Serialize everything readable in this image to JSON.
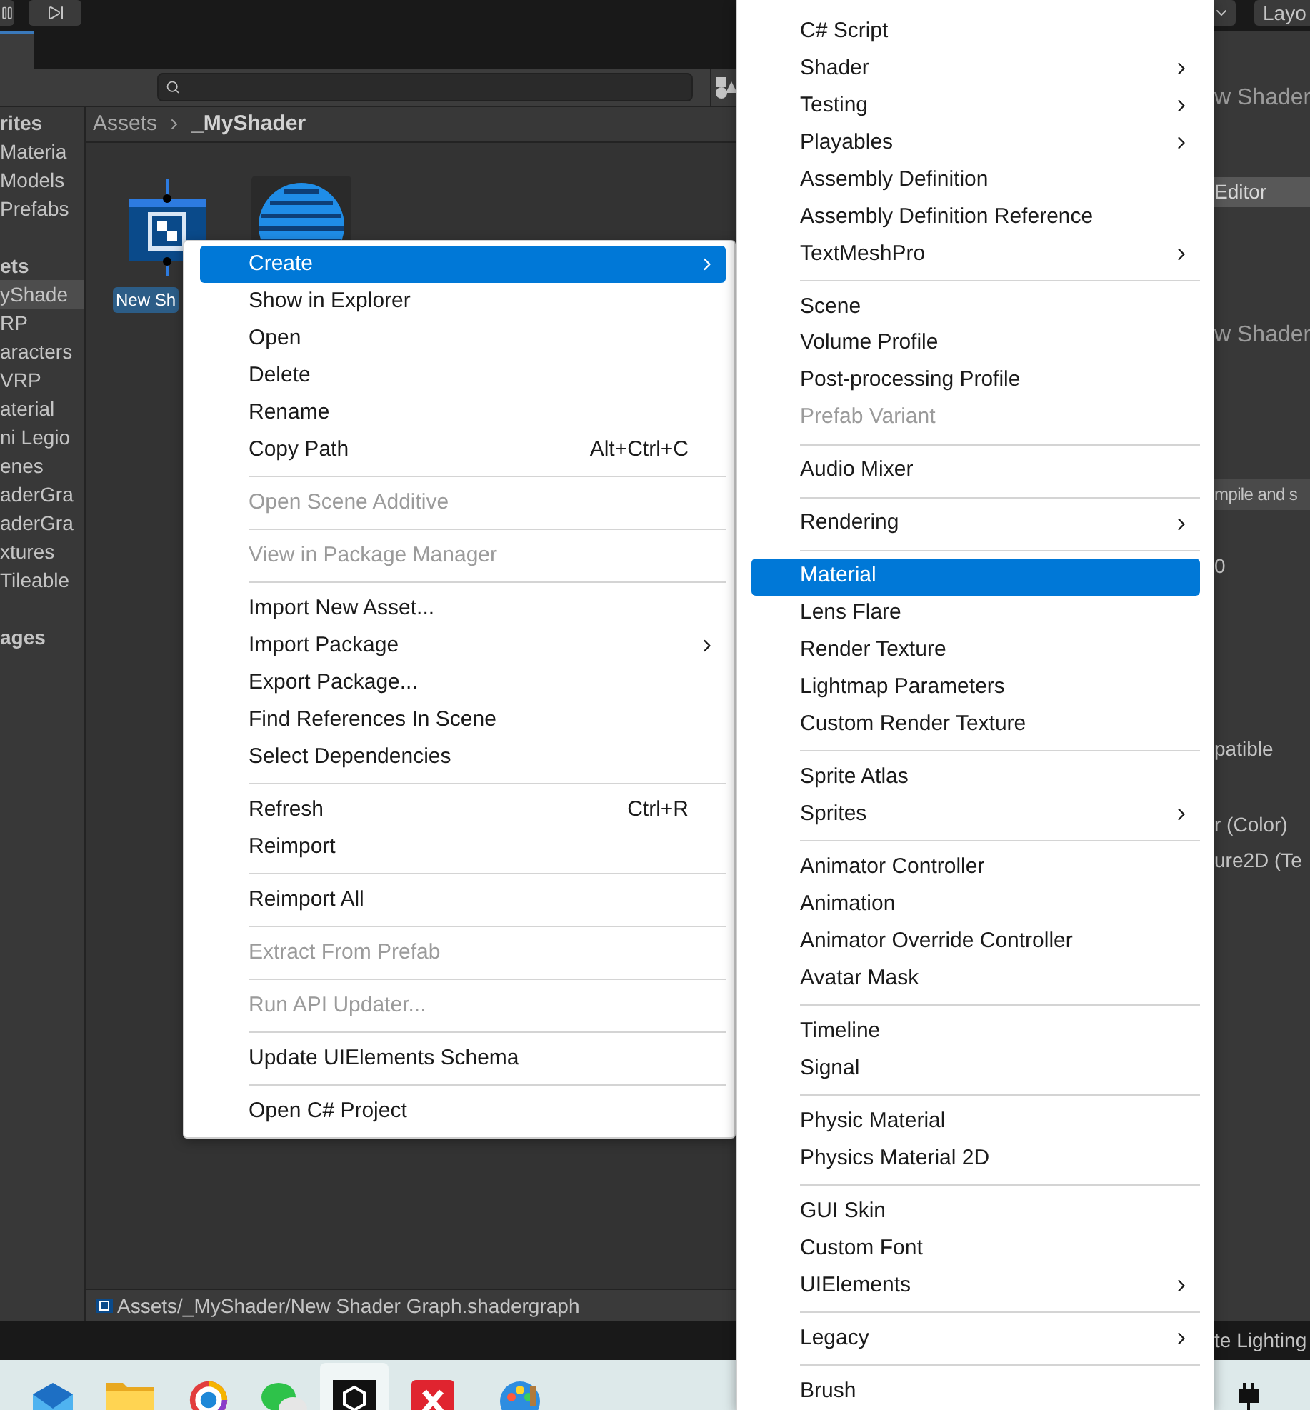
{
  "toolbar": {
    "layout_button": "Layo"
  },
  "sidebar": {
    "sections": [
      {
        "title": "rites",
        "items": [
          {
            "label": "Materia",
            "selected": false
          },
          {
            "label": "Models",
            "selected": false
          },
          {
            "label": "Prefabs",
            "selected": false
          }
        ]
      },
      {
        "title": "ets",
        "items": [
          {
            "label": "yShade",
            "selected": true
          },
          {
            "label": "RP",
            "selected": false
          },
          {
            "label": "aracters",
            "selected": false
          },
          {
            "label": "VRP",
            "selected": false
          },
          {
            "label": "aterial",
            "selected": false
          },
          {
            "label": "ni Legio",
            "selected": false
          },
          {
            "label": "enes",
            "selected": false
          },
          {
            "label": "aderGra",
            "selected": false
          },
          {
            "label": "aderGra",
            "selected": false
          },
          {
            "label": "xtures",
            "selected": false
          },
          {
            "label": "Tileable",
            "selected": false
          }
        ]
      },
      {
        "title": "ages"
      }
    ]
  },
  "breadcrumb": [
    "Assets",
    "_MyShader"
  ],
  "assets": [
    {
      "kind": "shader-graph",
      "label": "New Sh",
      "selected": true
    },
    {
      "kind": "material-sphere",
      "selected": false
    }
  ],
  "status_bar": {
    "path": "Assets/_MyShader/New Shader Graph.shadergraph"
  },
  "inspector": [
    {
      "kind": "title",
      "text": "w Shader"
    },
    {
      "kind": "button",
      "text": "Editor"
    },
    {
      "kind": "title",
      "text": "w Shader"
    },
    {
      "kind": "bar",
      "text": "mpile and s"
    },
    {
      "kind": "text",
      "text": "0"
    },
    {
      "kind": "text",
      "text": "patible"
    },
    {
      "kind": "text",
      "text": "r (Color)"
    },
    {
      "kind": "text",
      "text": "ure2D (Te"
    }
  ],
  "bottom_bar": {
    "text": "te Lighting"
  },
  "taskbar": [
    {
      "kind": "mail",
      "selected": false
    },
    {
      "kind": "folder",
      "selected": false
    },
    {
      "kind": "browser",
      "selected": false
    },
    {
      "kind": "chat",
      "selected": false
    },
    {
      "kind": "unity",
      "selected": true
    },
    {
      "kind": "xapp",
      "selected": false
    },
    {
      "kind": "palette",
      "selected": false
    }
  ],
  "context_menu": [
    {
      "kind": "item",
      "label": "Create",
      "selected": true,
      "disabled": false,
      "has_submenu": true
    },
    {
      "kind": "item",
      "label": "Show in Explorer",
      "selected": false,
      "disabled": false,
      "has_submenu": false
    },
    {
      "kind": "item",
      "label": "Open",
      "selected": false,
      "disabled": false,
      "has_submenu": false
    },
    {
      "kind": "item",
      "label": "Delete",
      "selected": false,
      "disabled": false,
      "has_submenu": false
    },
    {
      "kind": "item",
      "label": "Rename",
      "selected": false,
      "disabled": false,
      "has_submenu": false
    },
    {
      "kind": "item",
      "label": "Copy Path",
      "shortcut": "Alt+Ctrl+C",
      "selected": false,
      "disabled": false,
      "has_submenu": false
    },
    {
      "kind": "separator"
    },
    {
      "kind": "item",
      "label": "Open Scene Additive",
      "selected": false,
      "disabled": true,
      "has_submenu": false
    },
    {
      "kind": "separator"
    },
    {
      "kind": "item",
      "label": "View in Package Manager",
      "selected": false,
      "disabled": true,
      "has_submenu": false
    },
    {
      "kind": "separator"
    },
    {
      "kind": "item",
      "label": "Import New Asset...",
      "selected": false,
      "disabled": false,
      "has_submenu": false
    },
    {
      "kind": "item",
      "label": "Import Package",
      "selected": false,
      "disabled": false,
      "has_submenu": true
    },
    {
      "kind": "item",
      "label": "Export Package...",
      "selected": false,
      "disabled": false,
      "has_submenu": false
    },
    {
      "kind": "item",
      "label": "Find References In Scene",
      "selected": false,
      "disabled": false,
      "has_submenu": false
    },
    {
      "kind": "item",
      "label": "Select Dependencies",
      "selected": false,
      "disabled": false,
      "has_submenu": false
    },
    {
      "kind": "separator"
    },
    {
      "kind": "item",
      "label": "Refresh",
      "shortcut": "Ctrl+R",
      "selected": false,
      "disabled": false,
      "has_submenu": false
    },
    {
      "kind": "item",
      "label": "Reimport",
      "selected": false,
      "disabled": false,
      "has_submenu": false
    },
    {
      "kind": "separator"
    },
    {
      "kind": "item",
      "label": "Reimport All",
      "selected": false,
      "disabled": false,
      "has_submenu": false
    },
    {
      "kind": "separator"
    },
    {
      "kind": "item",
      "label": "Extract From Prefab",
      "selected": false,
      "disabled": true,
      "has_submenu": false
    },
    {
      "kind": "separator"
    },
    {
      "kind": "item",
      "label": "Run API Updater...",
      "selected": false,
      "disabled": true,
      "has_submenu": false
    },
    {
      "kind": "separator"
    },
    {
      "kind": "item",
      "label": "Update UIElements Schema",
      "selected": false,
      "disabled": false,
      "has_submenu": false
    },
    {
      "kind": "separator"
    },
    {
      "kind": "item",
      "label": "Open C# Project",
      "selected": false,
      "disabled": false,
      "has_submenu": false
    }
  ],
  "create_submenu": [
    {
      "kind": "item",
      "label": "C# Script",
      "selected": false,
      "disabled": false,
      "has_submenu": false
    },
    {
      "kind": "item",
      "label": "Shader",
      "selected": false,
      "disabled": false,
      "has_submenu": true
    },
    {
      "kind": "item",
      "label": "Testing",
      "selected": false,
      "disabled": false,
      "has_submenu": true
    },
    {
      "kind": "item",
      "label": "Playables",
      "selected": false,
      "disabled": false,
      "has_submenu": true
    },
    {
      "kind": "item",
      "label": "Assembly Definition",
      "selected": false,
      "disabled": false,
      "has_submenu": false
    },
    {
      "kind": "item",
      "label": "Assembly Definition Reference",
      "selected": false,
      "disabled": false,
      "has_submenu": false
    },
    {
      "kind": "item",
      "label": "TextMeshPro",
      "selected": false,
      "disabled": false,
      "has_submenu": true
    },
    {
      "kind": "separator"
    },
    {
      "kind": "item",
      "label": "Scene",
      "selected": false,
      "disabled": false,
      "has_submenu": false
    },
    {
      "kind": "item",
      "label": "Volume Profile",
      "selected": false,
      "disabled": false,
      "has_submenu": false
    },
    {
      "kind": "item",
      "label": "Post-processing Profile",
      "selected": false,
      "disabled": false,
      "has_submenu": false
    },
    {
      "kind": "item",
      "label": "Prefab Variant",
      "selected": false,
      "disabled": true,
      "has_submenu": false
    },
    {
      "kind": "separator"
    },
    {
      "kind": "item",
      "label": "Audio Mixer",
      "selected": false,
      "disabled": false,
      "has_submenu": false
    },
    {
      "kind": "separator"
    },
    {
      "kind": "item",
      "label": "Rendering",
      "selected": false,
      "disabled": false,
      "has_submenu": true
    },
    {
      "kind": "separator"
    },
    {
      "kind": "item",
      "label": "Material",
      "selected": true,
      "disabled": false,
      "has_submenu": false
    },
    {
      "kind": "item",
      "label": "Lens Flare",
      "selected": false,
      "disabled": false,
      "has_submenu": false
    },
    {
      "kind": "item",
      "label": "Render Texture",
      "selected": false,
      "disabled": false,
      "has_submenu": false
    },
    {
      "kind": "item",
      "label": "Lightmap Parameters",
      "selected": false,
      "disabled": false,
      "has_submenu": false
    },
    {
      "kind": "item",
      "label": "Custom Render Texture",
      "selected": false,
      "disabled": false,
      "has_submenu": false
    },
    {
      "kind": "separator"
    },
    {
      "kind": "item",
      "label": "Sprite Atlas",
      "selected": false,
      "disabled": false,
      "has_submenu": false
    },
    {
      "kind": "item",
      "label": "Sprites",
      "selected": false,
      "disabled": false,
      "has_submenu": true
    },
    {
      "kind": "separator"
    },
    {
      "kind": "item",
      "label": "Animator Controller",
      "selected": false,
      "disabled": false,
      "has_submenu": false
    },
    {
      "kind": "item",
      "label": "Animation",
      "selected": false,
      "disabled": false,
      "has_submenu": false
    },
    {
      "kind": "item",
      "label": "Animator Override Controller",
      "selected": false,
      "disabled": false,
      "has_submenu": false
    },
    {
      "kind": "item",
      "label": "Avatar Mask",
      "selected": false,
      "disabled": false,
      "has_submenu": false
    },
    {
      "kind": "separator"
    },
    {
      "kind": "item",
      "label": "Timeline",
      "selected": false,
      "disabled": false,
      "has_submenu": false
    },
    {
      "kind": "item",
      "label": "Signal",
      "selected": false,
      "disabled": false,
      "has_submenu": false
    },
    {
      "kind": "separator"
    },
    {
      "kind": "item",
      "label": "Physic Material",
      "selected": false,
      "disabled": false,
      "has_submenu": false
    },
    {
      "kind": "item",
      "label": "Physics Material 2D",
      "selected": false,
      "disabled": false,
      "has_submenu": false
    },
    {
      "kind": "separator"
    },
    {
      "kind": "item",
      "label": "GUI Skin",
      "selected": false,
      "disabled": false,
      "has_submenu": false
    },
    {
      "kind": "item",
      "label": "Custom Font",
      "selected": false,
      "disabled": false,
      "has_submenu": false
    },
    {
      "kind": "item",
      "label": "UIElements",
      "selected": false,
      "disabled": false,
      "has_submenu": true
    },
    {
      "kind": "separator"
    },
    {
      "kind": "item",
      "label": "Legacy",
      "selected": false,
      "disabled": false,
      "has_submenu": true
    },
    {
      "kind": "separator"
    },
    {
      "kind": "item",
      "label": "Brush",
      "selected": false,
      "disabled": false,
      "has_submenu": false
    }
  ]
}
